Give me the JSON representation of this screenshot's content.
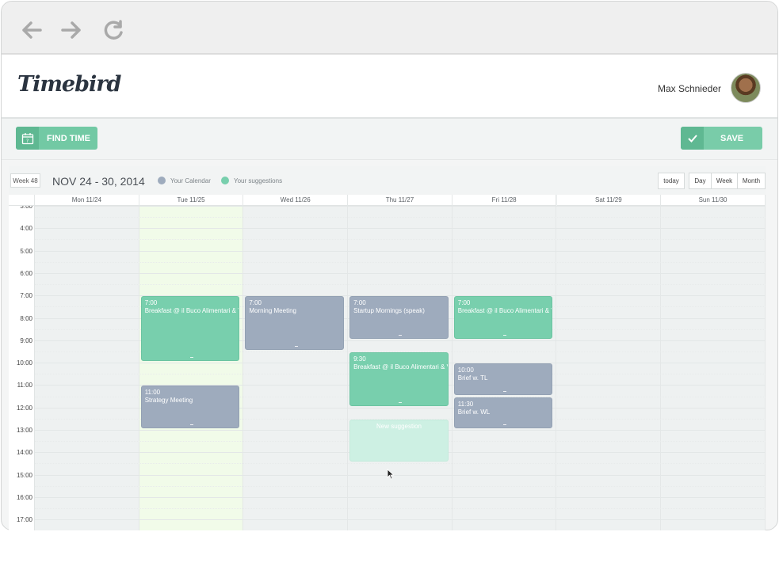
{
  "browser": {
    "back_icon": "arrow-left-icon",
    "forward_icon": "arrow-right-icon",
    "reload_icon": "reload-icon"
  },
  "app": {
    "logo": "Timebird",
    "user_name": "Max Schnieder"
  },
  "toolbar": {
    "find_time_label": "FIND TIME",
    "find_time_icon": "calendar-question-icon",
    "save_label": "SAVE",
    "save_icon": "checkmark-icon"
  },
  "calendar": {
    "week_badge": "Week 48",
    "date_range": "NOV 24 - 30, 2014",
    "legend": [
      {
        "label": "Your Calendar",
        "color": "#9eabbd"
      },
      {
        "label": "Your suggestions",
        "color": "#78cfad"
      }
    ],
    "today_label": "today",
    "views": [
      "Day",
      "Week",
      "Month"
    ],
    "days": [
      "Mon 11/24",
      "Tue 11/25",
      "Wed 11/26",
      "Thu 11/27",
      "Fri 11/28",
      "Sat 11/29",
      "Sun 11/30"
    ],
    "highlight_day_index": 1,
    "hours": [
      "3:00",
      "4:00",
      "5:00",
      "6:00",
      "7:00",
      "8:00",
      "9:00",
      "10:00",
      "11:00",
      "12:00",
      "13:00",
      "14:00",
      "15:00",
      "16:00",
      "17:00"
    ],
    "events": [
      {
        "day": 1,
        "start": 7.0,
        "end": 10.0,
        "time": "7:00",
        "title": "Breakfast @ il Buco Alimentari & Vineria",
        "kind": "suggestion"
      },
      {
        "day": 1,
        "start": 11.0,
        "end": 13.0,
        "time": "11:00",
        "title": "Strategy Meeting",
        "kind": "calendar"
      },
      {
        "day": 2,
        "start": 7.0,
        "end": 9.5,
        "time": "7:00",
        "title": "Morning Meeting",
        "kind": "calendar"
      },
      {
        "day": 3,
        "start": 7.0,
        "end": 9.0,
        "time": "7:00",
        "title": "Startup Mornings (speak)",
        "kind": "calendar"
      },
      {
        "day": 3,
        "start": 9.5,
        "end": 12.0,
        "time": "9:30",
        "title": "Breakfast @ il Buco Alimentari & Vineria",
        "kind": "suggestion"
      },
      {
        "day": 3,
        "start": 12.5,
        "end": 14.5,
        "time": "",
        "title": "New suggestion",
        "kind": "new"
      },
      {
        "day": 4,
        "start": 7.0,
        "end": 9.0,
        "time": "7:00",
        "title": "Breakfast @ il Buco Alimentari & Vineria",
        "kind": "suggestion"
      },
      {
        "day": 4,
        "start": 10.0,
        "end": 11.5,
        "time": "10:00",
        "title": "Brief w. TL",
        "kind": "calendar"
      },
      {
        "day": 4,
        "start": 11.5,
        "end": 13.0,
        "time": "11:30",
        "title": "Brief w. WL",
        "kind": "calendar"
      }
    ]
  }
}
